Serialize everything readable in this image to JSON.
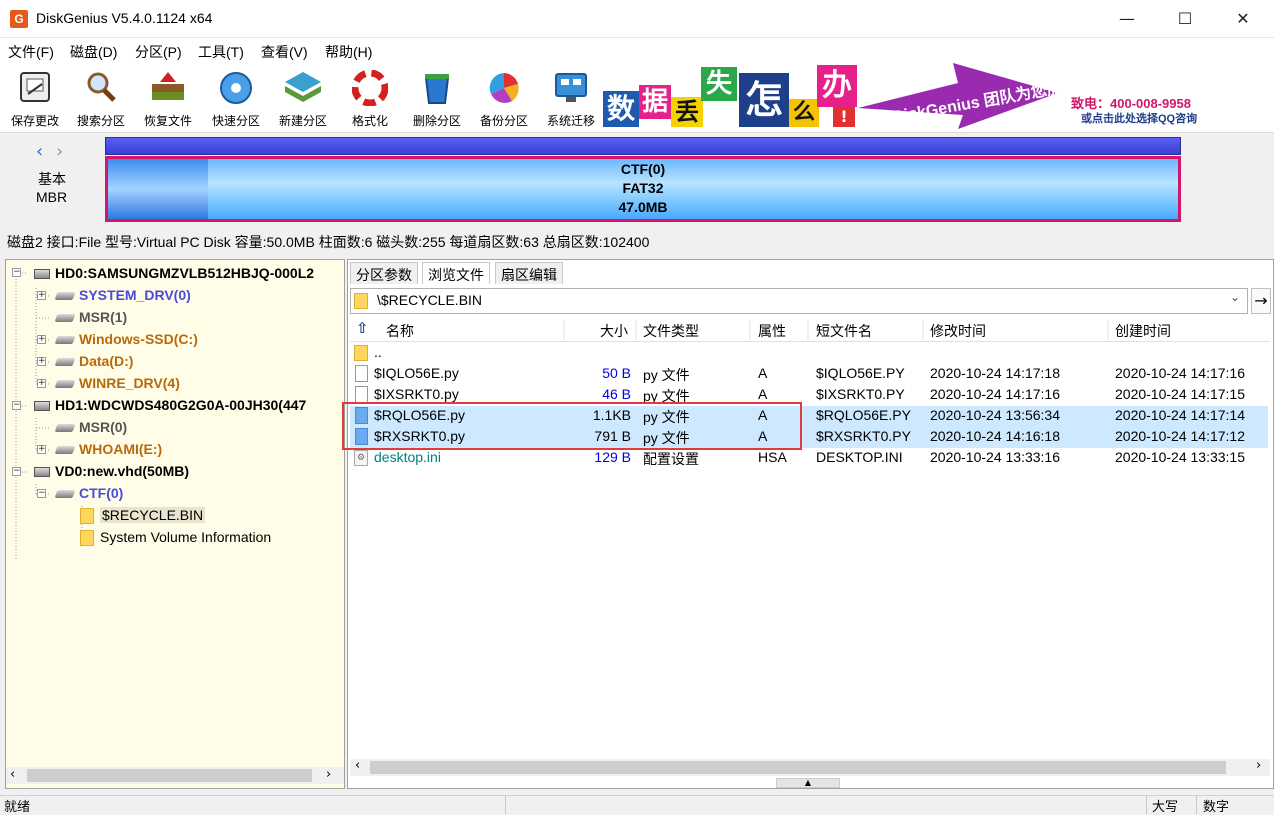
{
  "window": {
    "title": "DiskGenius V5.4.0.1124 x64",
    "app_icon": "G",
    "controls": [
      "—",
      "☐",
      "✕"
    ]
  },
  "menu": [
    "文件(F)",
    "磁盘(D)",
    "分区(P)",
    "工具(T)",
    "查看(V)",
    "帮助(H)"
  ],
  "toolbar": [
    {
      "label": "保存更改",
      "icon": "save-icon"
    },
    {
      "label": "搜索分区",
      "icon": "search-icon"
    },
    {
      "label": "恢复文件",
      "icon": "recover-icon"
    },
    {
      "label": "快速分区",
      "icon": "quick-partition-icon"
    },
    {
      "label": "新建分区",
      "icon": "new-partition-icon"
    },
    {
      "label": "格式化",
      "icon": "format-icon"
    },
    {
      "label": "删除分区",
      "icon": "delete-icon"
    },
    {
      "label": "备份分区",
      "icon": "backup-icon"
    },
    {
      "label": "系统迁移",
      "icon": "migrate-icon"
    }
  ],
  "banner": {
    "chars": [
      "数",
      "据",
      "丢",
      "失",
      "怎",
      "么",
      "办",
      "!"
    ],
    "slogan": "DiskGenius 团队为您服务",
    "phone": "致电：400-008-9958",
    "qq": "或点击此处选择QQ咨询"
  },
  "diskmap": {
    "type_label": "基本",
    "scheme": "MBR",
    "partition_name": "CTF(0)",
    "fs": "FAT32",
    "size": "47.0MB"
  },
  "disk_info": "磁盘2 接口:File  型号:Virtual PC Disk  容量:50.0MB  柱面数:6  磁头数:255  每道扇区数:63  总扇区数:102400",
  "tree": [
    {
      "label": "HD0:SAMSUNGMZVLB512HBJQ-000L2",
      "kind": "disk",
      "color": "#000000"
    },
    {
      "label": "SYSTEM_DRV(0)",
      "kind": "part",
      "color": "#4a4adb"
    },
    {
      "label": "MSR(1)",
      "kind": "part",
      "color": "#555555"
    },
    {
      "label": "Windows-SSD(C:)",
      "kind": "part",
      "color": "#b8690c"
    },
    {
      "label": "Data(D:)",
      "kind": "part",
      "color": "#b8690c"
    },
    {
      "label": "WINRE_DRV(4)",
      "kind": "part",
      "color": "#b8690c"
    },
    {
      "label": "HD1:WDCWDS480G2G0A-00JH30(447",
      "kind": "disk",
      "color": "#000000"
    },
    {
      "label": "MSR(0)",
      "kind": "part",
      "color": "#555555"
    },
    {
      "label": "WHOAMI(E:)",
      "kind": "part",
      "color": "#b8690c"
    },
    {
      "label": "VD0:new.vhd(50MB)",
      "kind": "disk",
      "color": "#000000"
    },
    {
      "label": "CTF(0)",
      "kind": "part",
      "color": "#4a4adb"
    },
    {
      "label": "$RECYCLE.BIN",
      "kind": "folder",
      "color": "#000000"
    },
    {
      "label": "System Volume Information",
      "kind": "folder",
      "color": "#000000"
    }
  ],
  "tabs": [
    "分区参数",
    "浏览文件",
    "扇区编辑"
  ],
  "path": "\\$RECYCLE.BIN",
  "columns": [
    "名称",
    "大小",
    "文件类型",
    "属性",
    "短文件名",
    "修改时间",
    "创建时间"
  ],
  "files": [
    {
      "name": "..",
      "size": "",
      "type": "",
      "attr": "",
      "short": "",
      "mtime": "",
      "ctime": "",
      "selected": false
    },
    {
      "name": "$IQLO56E.py",
      "size": "50 B",
      "type": "py 文件",
      "attr": "A",
      "short": "$IQLO56E.PY",
      "mtime": "2020-10-24 14:17:18",
      "ctime": "2020-10-24 14:17:16",
      "selected": false
    },
    {
      "name": "$IXSRKT0.py",
      "size": "46 B",
      "type": "py 文件",
      "attr": "A",
      "short": "$IXSRKT0.PY",
      "mtime": "2020-10-24 14:17:16",
      "ctime": "2020-10-24 14:17:15",
      "selected": false
    },
    {
      "name": "$RQLO56E.py",
      "size": "1.1KB",
      "type": "py 文件",
      "attr": "A",
      "short": "$RQLO56E.PY",
      "mtime": "2020-10-24 13:56:34",
      "ctime": "2020-10-24 14:17:14",
      "selected": true
    },
    {
      "name": "$RXSRKT0.py",
      "size": "791 B",
      "type": "py 文件",
      "attr": "A",
      "short": "$RXSRKT0.PY",
      "mtime": "2020-10-24 14:16:18",
      "ctime": "2020-10-24 14:17:12",
      "selected": true
    },
    {
      "name": "desktop.ini",
      "size": "129 B",
      "type": "配置设置",
      "attr": "HSA",
      "short": "DESKTOP.INI",
      "mtime": "2020-10-24 13:33:16",
      "ctime": "2020-10-24 13:33:15",
      "selected": false
    }
  ],
  "status": {
    "left": "就绪",
    "caps": "大写",
    "num": "数字"
  },
  "colors": {
    "partition_border": "#d4166b",
    "selection": "#cde8ff",
    "highlight_box": "#e03c3c",
    "hidden_file": "#008080",
    "size_blue": "#0000e0"
  }
}
